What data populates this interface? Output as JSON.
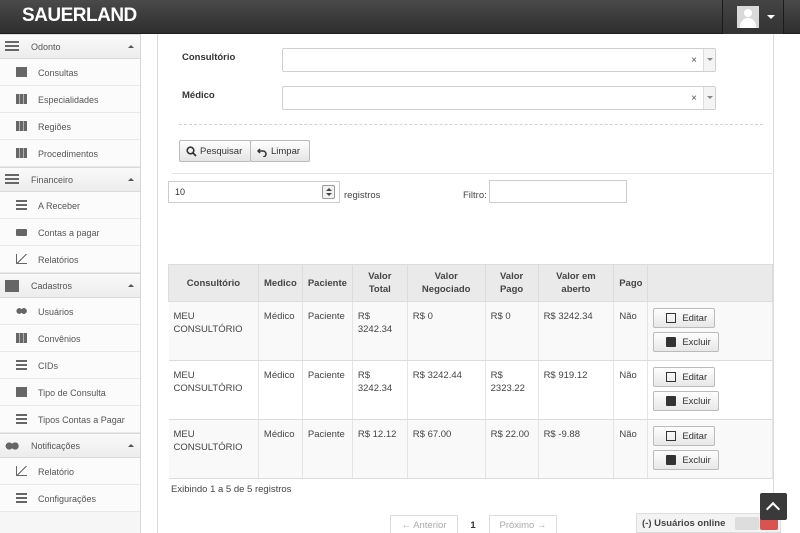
{
  "app": {
    "logo": "SAUERLAND"
  },
  "sidebar": {
    "sections": [
      {
        "label": "Odonto",
        "icon": "tooth-icon",
        "items": [
          {
            "label": "Consultas",
            "icon": "briefcase-icon"
          },
          {
            "label": "Especialidades",
            "icon": "building-icon"
          },
          {
            "label": "Regiões",
            "icon": "building-icon"
          },
          {
            "label": "Procedimentos",
            "icon": "building-icon"
          }
        ]
      },
      {
        "label": "Financeiro",
        "icon": "calculator-icon",
        "items": [
          {
            "label": "A Receber",
            "icon": "money-stack-icon"
          },
          {
            "label": "Contas a pagar",
            "icon": "credit-card-icon"
          },
          {
            "label": "Relatórios",
            "icon": "bar-chart-icon"
          }
        ]
      },
      {
        "label": "Cadastros",
        "icon": "book-icon",
        "items": [
          {
            "label": "Usuários",
            "icon": "users-icon"
          },
          {
            "label": "Convênios",
            "icon": "building-icon"
          },
          {
            "label": "CIDs",
            "icon": "list-icon"
          },
          {
            "label": "Tipo de Consulta",
            "icon": "address-book-icon"
          },
          {
            "label": "Tipos Contas a Pagar",
            "icon": "receipt-icon"
          }
        ]
      },
      {
        "label": "Notificações",
        "icon": "broadcast-icon",
        "items": [
          {
            "label": "Relatório",
            "icon": "line-chart-icon"
          },
          {
            "label": "Configurações",
            "icon": "sliders-icon"
          }
        ]
      }
    ]
  },
  "filters": {
    "consultorio_label": "Consultório",
    "medico_label": "Médico",
    "clear_glyph": "×",
    "search_button": "Pesquisar",
    "clear_button": "Limpar"
  },
  "table_controls": {
    "page_length": "10",
    "registros_label": "registros",
    "filter_label": "Filtro:"
  },
  "table": {
    "headers": [
      "Consultório",
      "Medico",
      "Paciente",
      "Valor Total",
      "Valor Negociado",
      "Valor Pago",
      "Valor em aberto",
      "Pago"
    ],
    "rows": [
      {
        "consultorio": "MEU CONSULTÓRIO",
        "medico": "Médico",
        "paciente": "Paciente",
        "total": "R$ 3242.34",
        "negociado": "R$ 0",
        "pago_valor": "R$ 0",
        "aberto": "R$ 3242.34",
        "pago": "Não"
      },
      {
        "consultorio": "MEU CONSULTÓRIO",
        "medico": "Médico",
        "paciente": "Paciente",
        "total": "R$ 3242.34",
        "negociado": "R$ 3242.44",
        "pago_valor": "R$ 2323.22",
        "aberto": "R$ 919.12",
        "pago": "Não"
      },
      {
        "consultorio": "MEU CONSULTÓRIO",
        "medico": "Médico",
        "paciente": "Paciente",
        "total": "R$ 12.12",
        "negociado": "R$ 67.00",
        "pago_valor": "R$ 22.00",
        "aberto": "R$ -9.88",
        "pago": "Não"
      }
    ],
    "edit_label": "Editar",
    "delete_label": "Excluir",
    "info": "Exibindo 1 a 5 de 5 registros"
  },
  "pagination": {
    "prev": "← Anterior",
    "page": "1",
    "next": "Próximo →"
  },
  "online_widget": {
    "label": "(-) Usuários online"
  }
}
